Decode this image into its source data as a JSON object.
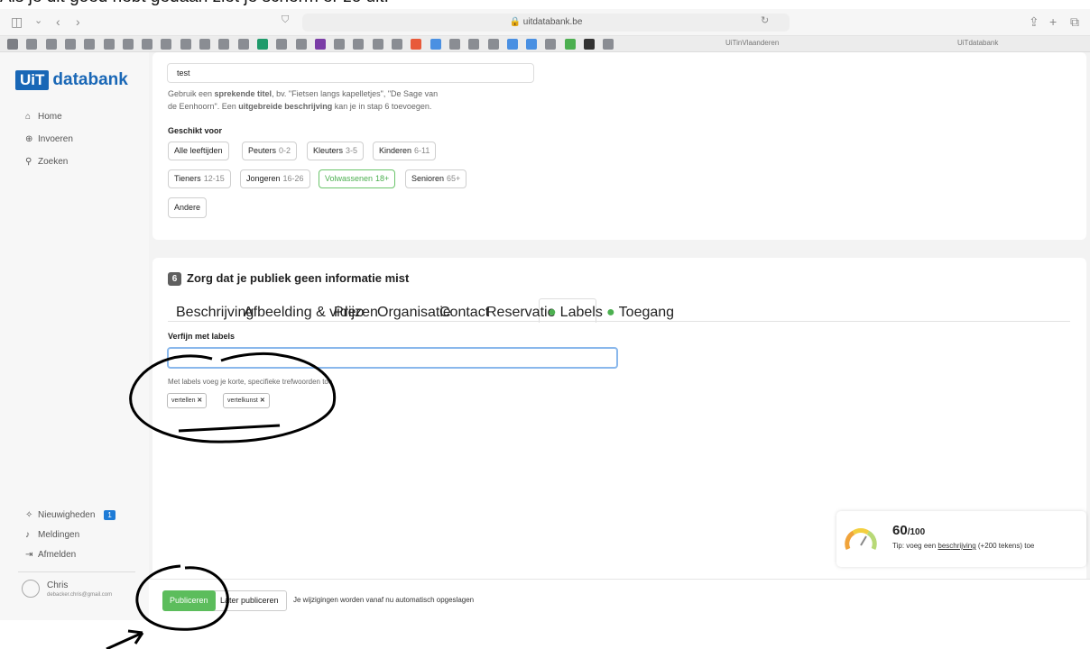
{
  "caption": "Als je dit goed hebt gedaan ziet je scherm er zo uit:",
  "browser": {
    "url": "uitdatabank.be",
    "tabs": [
      "UiTinVlaanderen",
      "UiTdatabank"
    ]
  },
  "sidebar": {
    "logo_box": "UiT",
    "logo_text": "databank",
    "nav": [
      {
        "icon": "home-icon",
        "glyph": "⌂",
        "label": "Home"
      },
      {
        "icon": "plus-circle-icon",
        "glyph": "⊕",
        "label": "Invoeren"
      },
      {
        "icon": "search-icon",
        "glyph": "⚲",
        "label": "Zoeken"
      }
    ],
    "bottom": [
      {
        "icon": "gift-icon",
        "glyph": "✧",
        "label": "Nieuwigheden",
        "badge": "1"
      },
      {
        "icon": "bell-icon",
        "glyph": "♪",
        "label": "Meldingen"
      },
      {
        "icon": "logout-icon",
        "glyph": "⇥",
        "label": "Afmelden"
      }
    ],
    "user": {
      "name": "Chris",
      "email": "debacker.chris@gmail.com"
    }
  },
  "title_section": {
    "value": "test",
    "hint_line1_pre": "Gebruik een ",
    "hint_line1_bold": "sprekende titel",
    "hint_line1_post": ", bv. \"Fietsen langs kapelletjes\", \"De Sage van",
    "hint_line2_pre": "de Eenhoorn\". Een ",
    "hint_line2_bold": "uitgebreide beschrijving",
    "hint_line2_post": " kan je in stap 6 toevoegen.",
    "suitable_label": "Geschikt voor",
    "audience": [
      {
        "label": "Alle leeftijden",
        "age": ""
      },
      {
        "label": "Peuters",
        "age": "0-2"
      },
      {
        "label": "Kleuters",
        "age": "3-5"
      },
      {
        "label": "Kinderen",
        "age": "6-11"
      },
      {
        "label": "Tieners",
        "age": "12-15"
      },
      {
        "label": "Jongeren",
        "age": "16-26"
      },
      {
        "label": "Volwassenen",
        "age": "18+",
        "active": true
      },
      {
        "label": "Senioren",
        "age": "65+"
      },
      {
        "label": "Andere",
        "age": ""
      }
    ]
  },
  "step6": {
    "number": "6",
    "title": "Zorg dat je publiek geen informatie mist",
    "tabs": [
      {
        "label": "Beschrijving",
        "done": false
      },
      {
        "label": "Afbeelding & video",
        "done": false
      },
      {
        "label": "Prijzen",
        "done": false
      },
      {
        "label": "Organisatie",
        "done": false
      },
      {
        "label": "Contact",
        "done": false
      },
      {
        "label": "Reservatie",
        "done": false
      },
      {
        "label": "Labels",
        "done": true,
        "active": true
      },
      {
        "label": "Toegang",
        "done": true
      }
    ],
    "labels_heading": "Verfijn met labels",
    "labels_value": "",
    "labels_hint": "Met labels voeg je korte, specifieke trefwoorden toe",
    "tags": [
      "vertellen",
      "vertelkunst"
    ]
  },
  "score": {
    "value": "60",
    "max": "/100",
    "tip_pre": "Tip: voeg een ",
    "tip_link": "beschrijving",
    "tip_post": " (+200 tekens) toe",
    "level": 0.6
  },
  "footer": {
    "publish": "Publiceren",
    "later": "Later publiceren",
    "autosave": "Je wijzigingen worden vanaf nu automatisch opgeslagen"
  },
  "colors": {
    "brand": "#1967b6",
    "green": "#5cbd5c",
    "focus": "#8ab8ec"
  }
}
